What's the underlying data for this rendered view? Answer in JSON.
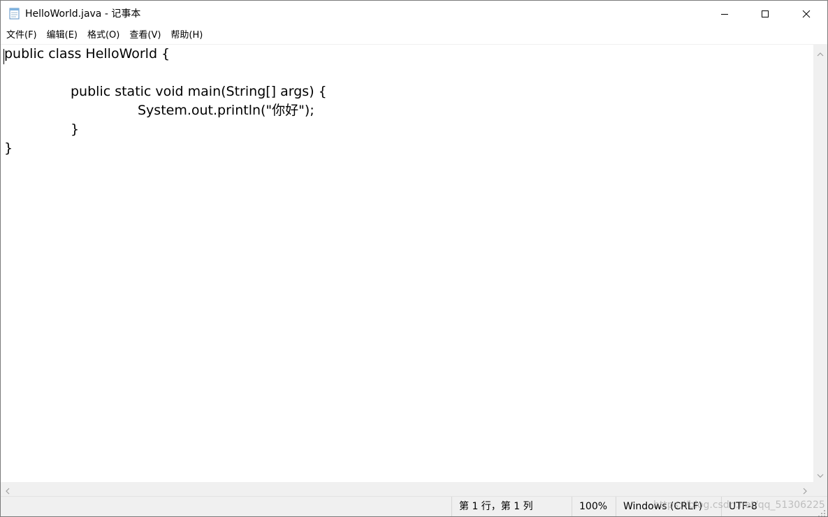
{
  "window": {
    "title": "HelloWorld.java - 记事本",
    "icon": "notepad-icon",
    "controls": [
      "minimize-icon",
      "maximize-icon",
      "close-icon"
    ]
  },
  "menu": {
    "items": [
      "文件(F)",
      "编辑(E)",
      "格式(O)",
      "查看(V)",
      "帮助(H)"
    ]
  },
  "editor": {
    "lines": [
      "public class HelloWorld {",
      "",
      "\t\tpublic static void main(String[] args) {",
      "\t\t\t\tSystem.out.println(\"你好\");",
      "\t\t}",
      "}"
    ]
  },
  "status": {
    "position": "第 1 行，第 1 列",
    "zoom": "100%",
    "line_endings": "Windows (CRLF)",
    "encoding": "UTF-8",
    "watermark": "https://blog.csdn.net/qq_51306225"
  },
  "colors": {
    "background": "#ffffff",
    "chrome": "#f0f0f0",
    "text": "#000000"
  }
}
